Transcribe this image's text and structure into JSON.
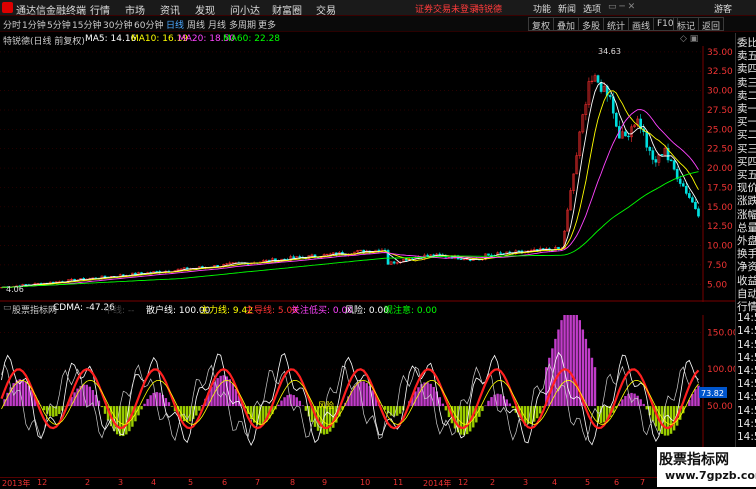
{
  "menubar": {
    "title": "通达信金融终端",
    "items": [
      "行情",
      "市场",
      "资讯",
      "发现",
      "问小达",
      "财富圈",
      "交易"
    ],
    "warning": "证券交易未登录",
    "stock_tag": "特锐德",
    "right_items": [
      "功能",
      "新闻",
      "选项",
      "游客"
    ]
  },
  "toolbar": {
    "periods": [
      "分时",
      "1分钟",
      "5分钟",
      "15分钟",
      "30分钟",
      "60分钟",
      "日线",
      "周线",
      "月线",
      "多周期",
      "更多"
    ],
    "active": "日线",
    "right": [
      "复权",
      "叠加",
      "多股",
      "统计",
      "画线",
      "F10",
      "标记",
      "返回"
    ]
  },
  "chart_header": {
    "name": "特锐德(日线 前复权)",
    "ma5": "MA5: 14.16",
    "ma10": "MA10: 16.19",
    "ma20": "MA20: 18.50",
    "ma60": "MA60: 22.28",
    "peak_label": "34.63",
    "low_label": "4.06",
    "colors": {
      "ma5": "#ffffff",
      "ma10": "#ffff00",
      "ma20": "#ff44ff",
      "ma60": "#00ff00"
    }
  },
  "price_axis": [
    "35.00",
    "32.50",
    "30.00",
    "27.50",
    "25.00",
    "22.50",
    "20.00",
    "17.50",
    "15.00",
    "12.50",
    "10.00",
    "7.50",
    "5.00"
  ],
  "indicator_header": {
    "name": "股票指标网",
    "cdma": "CDMA: -47.26",
    "faded": "中线: --",
    "retail": "散户线: 100.00",
    "main": "主力线: 9.42",
    "lead": "主导线: 5.00",
    "focus": "关注低买: 0.00",
    "risk": "风险: 0.00",
    "watch": "观注意: 0.00"
  },
  "indicator_axis": [
    "150.00",
    "100.00",
    "50.00"
  ],
  "indicator_value": "73.82",
  "indicator_signal": "风险",
  "right_panel": [
    "委比",
    "卖五",
    "卖四",
    "卖三",
    "卖二",
    "卖一",
    "买一",
    "买二",
    "买三",
    "买四",
    "买五",
    "现价",
    "涨跌",
    "涨幅",
    "总量",
    "外盘",
    "换手",
    "净资",
    "收益",
    "自动",
    "行情",
    "14:5",
    "14:5",
    "14:5",
    "14:5",
    "14:5",
    "14:5",
    "14:5",
    "14:5",
    "14:5",
    "14:5"
  ],
  "x_axis": [
    "2013年",
    "12",
    "2",
    "3",
    "4",
    "5",
    "6",
    "7",
    "8",
    "9",
    "10",
    "11",
    "2014年",
    "12",
    "2",
    "3",
    "4",
    "5",
    "6",
    "7"
  ],
  "watermark": {
    "line1": "股票指标网",
    "line2": "www.7gpzb.com"
  }
}
